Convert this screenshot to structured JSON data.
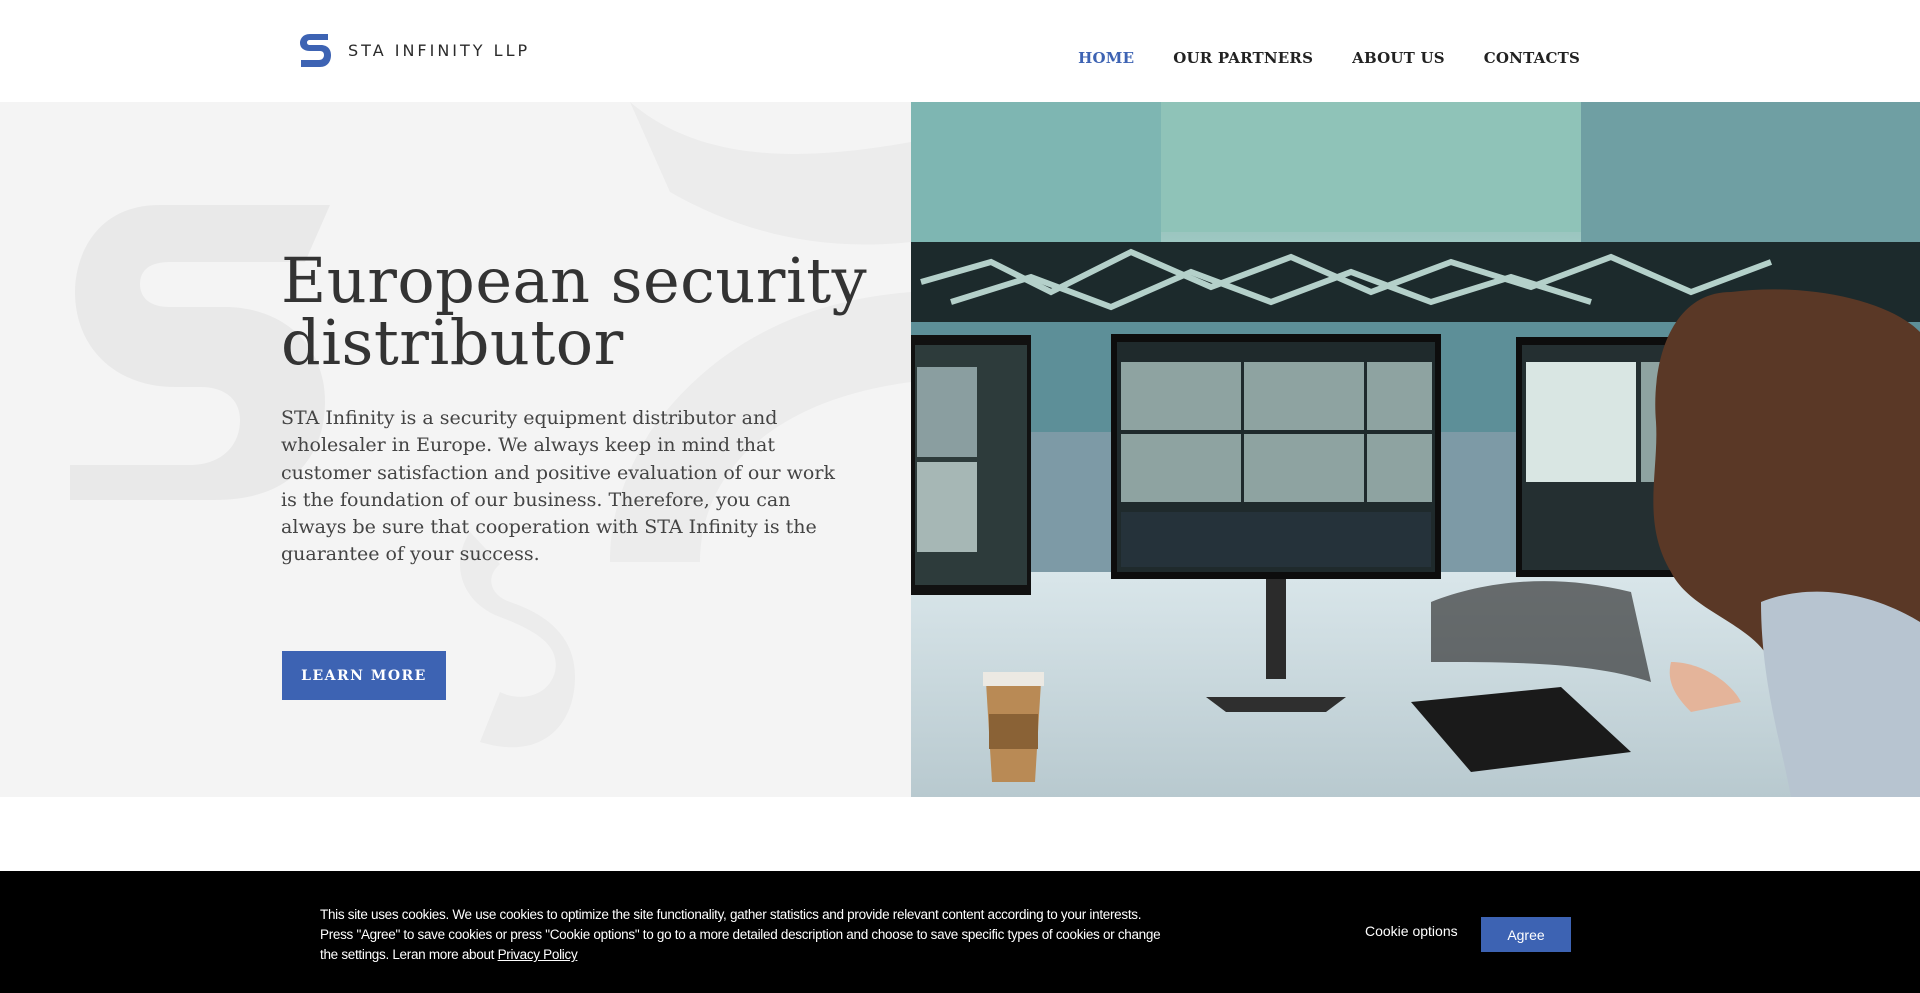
{
  "header": {
    "logo_text": "STA INFINITY LLP",
    "nav": [
      {
        "label": "HOME",
        "active": true
      },
      {
        "label": "OUR PARTNERS",
        "active": false
      },
      {
        "label": "ABOUT US",
        "active": false
      },
      {
        "label": "CONTACTS",
        "active": false
      }
    ]
  },
  "hero": {
    "title_line1": "European security",
    "title_line2": "distributor",
    "description": "STA Infinity is a security equipment distributor and wholesaler in Europe. We always keep in mind that customer satisfaction and positive evaluation of our work is the foundation of our business. Therefore, you can always be sure that cooperation with STA Infinity is the guarantee of your success.",
    "button_label": "LEARN MORE",
    "image_icon": "control-room-photo"
  },
  "cookie_bar": {
    "text": "This site uses cookies. We use cookies to optimize the site functionality, gather statistics and provide relevant content according to your interests. Press \"Agree\" to save cookies or press \"Cookie options\" to go to a more detailed description and choose to save specific types of cookies or change the settings. Leran more about",
    "privacy_link": "Privacy Policy",
    "options_label": "Cookie options",
    "agree_label": "Agree"
  },
  "colors": {
    "accent": "#3d63b3",
    "hero_bg": "#f4f4f4",
    "cookie_bg": "#000000"
  }
}
